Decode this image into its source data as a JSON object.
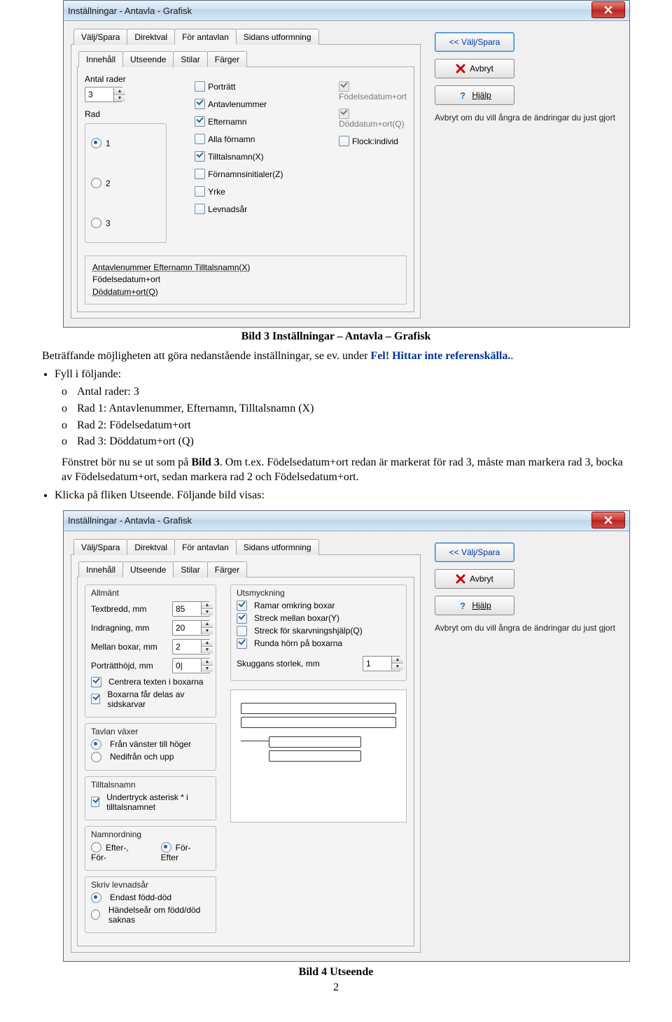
{
  "page_number": "2",
  "doc": {
    "caption1": "Bild 3 Inställningar – Antavla – Grafisk",
    "p1a": "Beträffande möjligheten att göra nedanstående inställningar, se ev. under ",
    "p1b": "Fel! Hittar inte referenskälla.",
    "p1c": ".",
    "bullet1": "Fyll i följande:",
    "o1": "Antal rader: 3",
    "o2": "Rad 1: Antavlenummer, Efternamn, Tilltalsnamn (X)",
    "o3": "Rad 2: Födelsedatum+ort",
    "o4": "Rad 3: Döddatum+ort (Q)",
    "p2": "Fönstret bör nu se ut som på ",
    "p2b": "Bild 3",
    "p2c": ". Om t.ex. Födelsedatum+ort redan är markerat för rad 3, måste man markera rad 3, bocka av Födelsedatum+ort, sedan markera rad 2 och Födelsedatum+ort.",
    "bullet2": "Klicka på fliken Utseende. Följande bild visas:",
    "caption2": "Bild 4 Utseende"
  },
  "win": {
    "title": "Inställningar - Antavla - Grafisk",
    "tabs": [
      "Välj/Spara",
      "Direktval",
      "För antavlan",
      "Sidans utformning"
    ]
  },
  "innehall": {
    "subtabs": [
      "Innehåll",
      "Utseende",
      "Stilar",
      "Färger"
    ],
    "antal_rader_label": "Antal rader",
    "antal_rader_value": "3",
    "rad_label": "Rad",
    "radios": [
      "1",
      "2",
      "3"
    ],
    "col2": [
      {
        "label": "Porträtt",
        "checked": false
      },
      {
        "label": "Antavlenummer",
        "checked": true
      },
      {
        "label": "Efternamn",
        "checked": true
      },
      {
        "label": "Alla förnamn",
        "checked": false
      },
      {
        "label": "Tilltalsnamn(X)",
        "checked": true
      },
      {
        "label": "Förnamnsinitialer(Z)",
        "checked": false
      },
      {
        "label": "Yrke",
        "checked": false
      },
      {
        "label": "Levnadsår",
        "checked": false
      }
    ],
    "col3": [
      {
        "label": "Födelsedatum+ort",
        "checked": true,
        "disabled": true
      },
      {
        "label": "Döddatum+ort(Q)",
        "checked": true,
        "disabled": true
      },
      {
        "label": "Flock:individ",
        "checked": false
      }
    ],
    "preview": [
      "Antavlenummer Efternamn Tilltalsnamn(X)",
      "Födelsedatum+ort",
      "Döddatum+ort(Q)"
    ]
  },
  "side": {
    "valj": "<< Välj/Spara",
    "avbryt": "Avbryt",
    "hjalp": "Hjälp",
    "text": "Avbryt om du vill ångra de ändringar du just gjort"
  },
  "utseende": {
    "subtabs": [
      "Innehåll",
      "Utseende",
      "Stilar",
      "Färger"
    ],
    "allmant_title": "Allmänt",
    "rows": [
      {
        "label": "Textbredd, mm",
        "value": "85"
      },
      {
        "label": "Indragning, mm",
        "value": "20"
      },
      {
        "label": "Mellan boxar, mm",
        "value": "2"
      },
      {
        "label": "Porträtthöjd, mm",
        "value": "0|"
      }
    ],
    "centrera": {
      "label": "Centrera texten i boxarna",
      "checked": true
    },
    "boxarna": {
      "label": "Boxarna får delas av sidskarvar",
      "checked": true
    },
    "tavlan_title": "Tavlan växer",
    "tavlan_r1": "Från vänster till höger",
    "tavlan_r2": "Nedifrån och upp",
    "tilltal_title": "Tilltalsnamn",
    "tilltal_chk": {
      "label": "Undertryck asterisk * i tilltalsnamnet",
      "checked": true
    },
    "namnordning_title": "Namnordning",
    "namn_r1": "Efter-, För-",
    "namn_r2": "För- Efter",
    "skriv_title": "Skriv levnadsår",
    "skriv_r1": "Endast född-död",
    "skriv_r2": "Händelseår om född/död saknas",
    "utsmyck_title": "Utsmyckning",
    "utsmyck": [
      {
        "label": "Ramar omkring boxar",
        "checked": true
      },
      {
        "label": "Streck mellan boxar(Y)",
        "checked": true
      },
      {
        "label": "Streck för skarvningshjälp(Q)",
        "checked": false
      },
      {
        "label": "Runda hörn på boxarna",
        "checked": true
      }
    ],
    "skugg_label": "Skuggans storlek, mm",
    "skugg_value": "1"
  }
}
